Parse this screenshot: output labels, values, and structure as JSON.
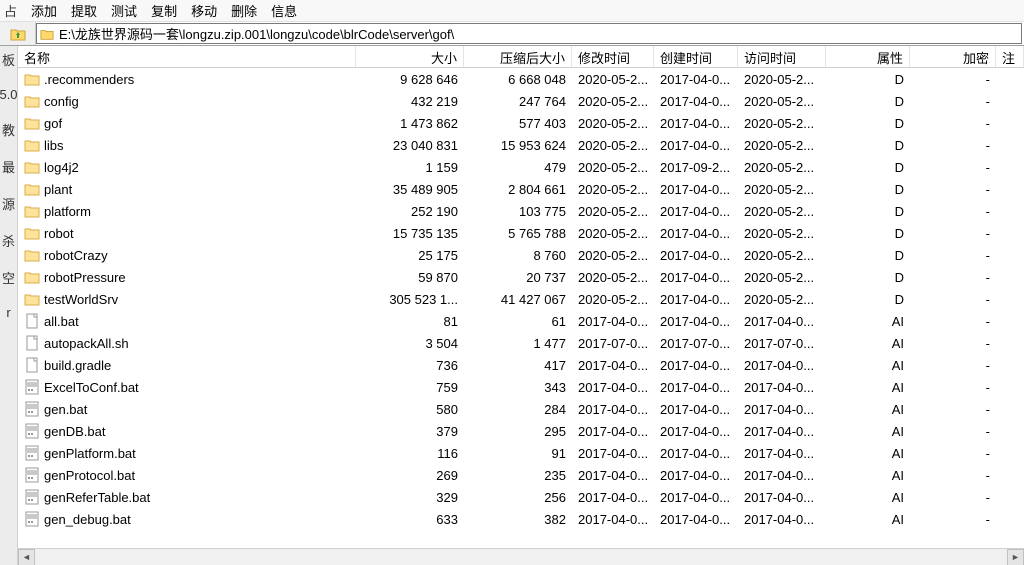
{
  "menu": {
    "items": [
      "添加",
      "提取",
      "测试",
      "复制",
      "移动",
      "删除",
      "信息"
    ],
    "leading_fragment": "占"
  },
  "path": "E:\\龙族世界源码一套\\longzu.zip.001\\longzu\\code\\blrCode\\server\\gof\\",
  "sidebar_labels": [
    "板",
    "5.0",
    "教",
    "最",
    "源",
    "杀",
    "空",
    "r"
  ],
  "columns": {
    "name": "名称",
    "size": "大小",
    "packed": "压缩后大小",
    "modified": "修改时间",
    "created": "创建时间",
    "accessed": "访问时间",
    "attributes": "属性",
    "encrypted": "加密",
    "annotation": "注"
  },
  "rows": [
    {
      "icon": "folder",
      "name": ".recommenders",
      "size": "9 628 646",
      "packed": "6 668 048",
      "mod": "2020-05-2...",
      "created": "2017-04-0...",
      "accessed": "2020-05-2...",
      "attr": "D",
      "enc": "-"
    },
    {
      "icon": "folder",
      "name": "config",
      "size": "432 219",
      "packed": "247 764",
      "mod": "2020-05-2...",
      "created": "2017-04-0...",
      "accessed": "2020-05-2...",
      "attr": "D",
      "enc": "-"
    },
    {
      "icon": "folder",
      "name": "gof",
      "size": "1 473 862",
      "packed": "577 403",
      "mod": "2020-05-2...",
      "created": "2017-04-0...",
      "accessed": "2020-05-2...",
      "attr": "D",
      "enc": "-"
    },
    {
      "icon": "folder",
      "name": "libs",
      "size": "23 040 831",
      "packed": "15 953 624",
      "mod": "2020-05-2...",
      "created": "2017-04-0...",
      "accessed": "2020-05-2...",
      "attr": "D",
      "enc": "-"
    },
    {
      "icon": "folder",
      "name": "log4j2",
      "size": "1 159",
      "packed": "479",
      "mod": "2020-05-2...",
      "created": "2017-09-2...",
      "accessed": "2020-05-2...",
      "attr": "D",
      "enc": "-"
    },
    {
      "icon": "folder",
      "name": "plant",
      "size": "35 489 905",
      "packed": "2 804 661",
      "mod": "2020-05-2...",
      "created": "2017-04-0...",
      "accessed": "2020-05-2...",
      "attr": "D",
      "enc": "-"
    },
    {
      "icon": "folder",
      "name": "platform",
      "size": "252 190",
      "packed": "103 775",
      "mod": "2020-05-2...",
      "created": "2017-04-0...",
      "accessed": "2020-05-2...",
      "attr": "D",
      "enc": "-"
    },
    {
      "icon": "folder",
      "name": "robot",
      "size": "15 735 135",
      "packed": "5 765 788",
      "mod": "2020-05-2...",
      "created": "2017-04-0...",
      "accessed": "2020-05-2...",
      "attr": "D",
      "enc": "-"
    },
    {
      "icon": "folder",
      "name": "robotCrazy",
      "size": "25 175",
      "packed": "8 760",
      "mod": "2020-05-2...",
      "created": "2017-04-0...",
      "accessed": "2020-05-2...",
      "attr": "D",
      "enc": "-"
    },
    {
      "icon": "folder",
      "name": "robotPressure",
      "size": "59 870",
      "packed": "20 737",
      "mod": "2020-05-2...",
      "created": "2017-04-0...",
      "accessed": "2020-05-2...",
      "attr": "D",
      "enc": "-"
    },
    {
      "icon": "folder",
      "name": "testWorldSrv",
      "size": "305 523 1...",
      "packed": "41 427 067",
      "mod": "2020-05-2...",
      "created": "2017-04-0...",
      "accessed": "2020-05-2...",
      "attr": "D",
      "enc": "-"
    },
    {
      "icon": "file",
      "name": "all.bat",
      "size": "81",
      "packed": "61",
      "mod": "2017-04-0...",
      "created": "2017-04-0...",
      "accessed": "2017-04-0...",
      "attr": "AI",
      "enc": "-"
    },
    {
      "icon": "file",
      "name": "autopackAll.sh",
      "size": "3 504",
      "packed": "1 477",
      "mod": "2017-07-0...",
      "created": "2017-07-0...",
      "accessed": "2017-07-0...",
      "attr": "AI",
      "enc": "-"
    },
    {
      "icon": "file",
      "name": "build.gradle",
      "size": "736",
      "packed": "417",
      "mod": "2017-04-0...",
      "created": "2017-04-0...",
      "accessed": "2017-04-0...",
      "attr": "AI",
      "enc": "-"
    },
    {
      "icon": "bat",
      "name": "ExcelToConf.bat",
      "size": "759",
      "packed": "343",
      "mod": "2017-04-0...",
      "created": "2017-04-0...",
      "accessed": "2017-04-0...",
      "attr": "AI",
      "enc": "-"
    },
    {
      "icon": "bat",
      "name": "gen.bat",
      "size": "580",
      "packed": "284",
      "mod": "2017-04-0...",
      "created": "2017-04-0...",
      "accessed": "2017-04-0...",
      "attr": "AI",
      "enc": "-"
    },
    {
      "icon": "bat",
      "name": "genDB.bat",
      "size": "379",
      "packed": "295",
      "mod": "2017-04-0...",
      "created": "2017-04-0...",
      "accessed": "2017-04-0...",
      "attr": "AI",
      "enc": "-"
    },
    {
      "icon": "bat",
      "name": "genPlatform.bat",
      "size": "116",
      "packed": "91",
      "mod": "2017-04-0...",
      "created": "2017-04-0...",
      "accessed": "2017-04-0...",
      "attr": "AI",
      "enc": "-"
    },
    {
      "icon": "bat",
      "name": "genProtocol.bat",
      "size": "269",
      "packed": "235",
      "mod": "2017-04-0...",
      "created": "2017-04-0...",
      "accessed": "2017-04-0...",
      "attr": "AI",
      "enc": "-"
    },
    {
      "icon": "bat",
      "name": "genReferTable.bat",
      "size": "329",
      "packed": "256",
      "mod": "2017-04-0...",
      "created": "2017-04-0...",
      "accessed": "2017-04-0...",
      "attr": "AI",
      "enc": "-"
    },
    {
      "icon": "bat",
      "name": "gen_debug.bat",
      "size": "633",
      "packed": "382",
      "mod": "2017-04-0...",
      "created": "2017-04-0...",
      "accessed": "2017-04-0...",
      "attr": "AI",
      "enc": "-"
    }
  ]
}
